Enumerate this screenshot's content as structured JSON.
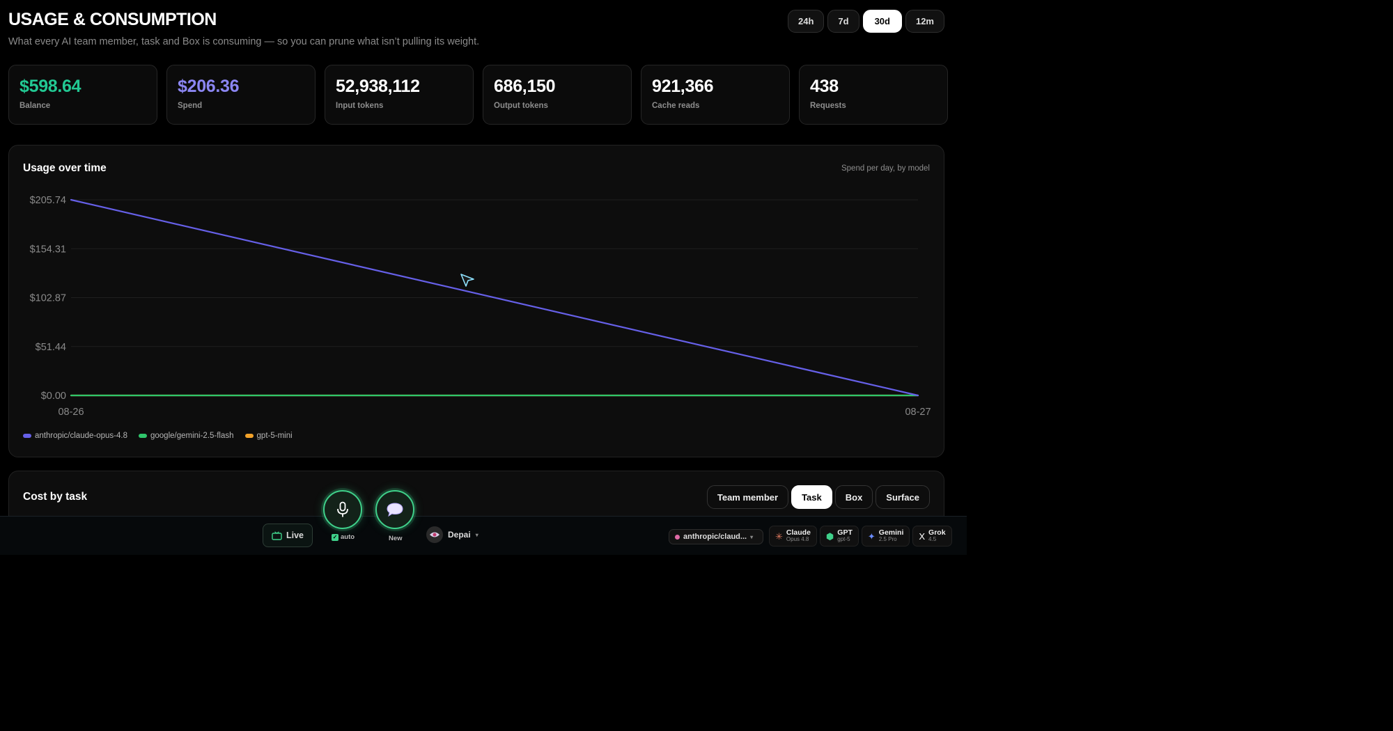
{
  "header": {
    "title": "USAGE & CONSUMPTION",
    "subtitle": "What every AI team member, task and Box is consuming — so you can prune what isn’t pulling its weight."
  },
  "ranges": [
    {
      "label": "24h",
      "active": false
    },
    {
      "label": "7d",
      "active": false
    },
    {
      "label": "30d",
      "active": true
    },
    {
      "label": "12m",
      "active": false
    }
  ],
  "stats": [
    {
      "value": "$598.64",
      "label": "Balance",
      "color": "#22c993"
    },
    {
      "value": "$206.36",
      "label": "Spend",
      "color": "#8b86f2"
    },
    {
      "value": "52,938,112",
      "label": "Input tokens",
      "color": "#ffffff"
    },
    {
      "value": "686,150",
      "label": "Output tokens",
      "color": "#ffffff"
    },
    {
      "value": "921,366",
      "label": "Cache reads",
      "color": "#ffffff"
    },
    {
      "value": "438",
      "label": "Requests",
      "color": "#ffffff"
    }
  ],
  "usage_card": {
    "title": "Usage over time",
    "note": "Spend per day, by model"
  },
  "chart_data": {
    "type": "line",
    "x": [
      "08-26",
      "08-27"
    ],
    "yticks": [
      "$0.00",
      "$51.44",
      "$102.87",
      "$154.31",
      "$205.74"
    ],
    "ylim": [
      0,
      205.74
    ],
    "grid": true,
    "legend_position": "bottom-left",
    "series": [
      {
        "name": "anthropic/claude-opus-4.8",
        "color": "#6660e8",
        "values": [
          205.74,
          0
        ]
      },
      {
        "name": "google/gemini-2.5-flash",
        "color": "#2fc56b",
        "values": [
          0,
          0
        ]
      },
      {
        "name": "gpt-5-mini",
        "color": "#f2a22a",
        "values": [
          0,
          0
        ]
      }
    ]
  },
  "cost_card": {
    "title": "Cost by task",
    "tabs": [
      {
        "label": "Team member",
        "active": false
      },
      {
        "label": "Task",
        "active": true
      },
      {
        "label": "Box",
        "active": false
      },
      {
        "label": "Surface",
        "active": false
      }
    ]
  },
  "bottom_bar": {
    "live_label": "Live",
    "auto_label": "auto",
    "new_label": "New",
    "workspace": "Depai",
    "model": "anthropic/claud...",
    "providers": [
      {
        "name": "Claude",
        "sub": "Opus 4.8",
        "icon": "claude-icon",
        "color": "#e07a5f",
        "glyph": "✳"
      },
      {
        "name": "GPT",
        "sub": "gpt-5",
        "icon": "gpt-icon",
        "color": "#3fd08a",
        "glyph": "⬢"
      },
      {
        "name": "Gemini",
        "sub": "2.5 Pro",
        "icon": "gemini-icon",
        "color": "#6a8cff",
        "glyph": "✦"
      },
      {
        "name": "Grok",
        "sub": "4.5",
        "icon": "grok-icon",
        "color": "#ffffff",
        "glyph": "X"
      }
    ]
  }
}
